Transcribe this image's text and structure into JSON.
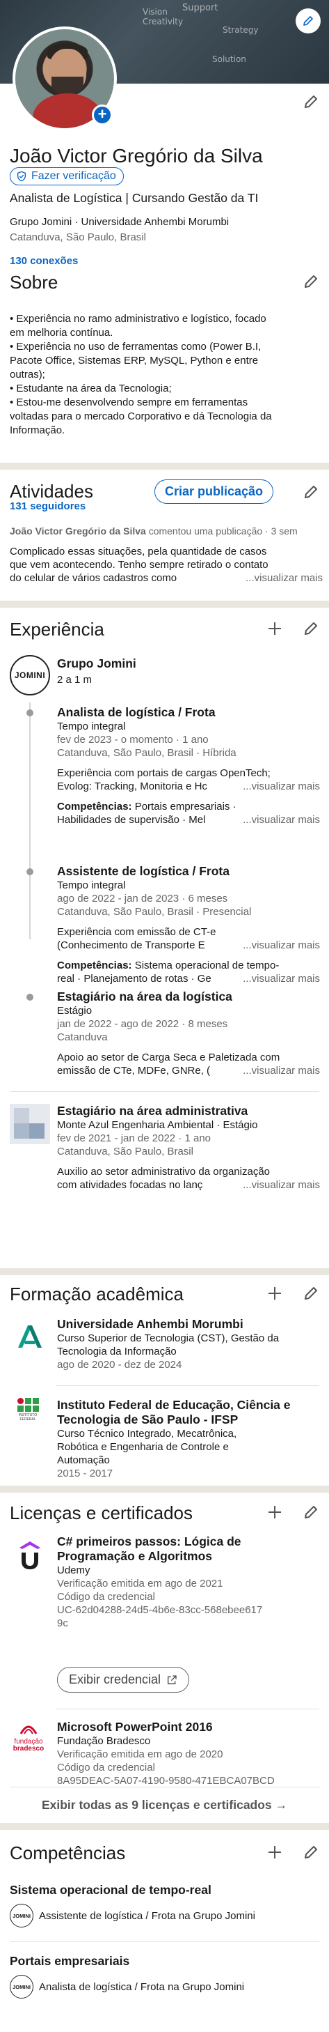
{
  "banner": {
    "doodles": [
      "Vision",
      "Creativity",
      "Support",
      "Strategy",
      "Solution"
    ]
  },
  "profile": {
    "name": "João Victor Gregório da Silva",
    "verify_label": "Fazer verificação",
    "headline": "Analista de Logística | Cursando Gestão da TI",
    "education_line": "Grupo Jomini · Universidade Anhembi Morumbi",
    "location": "Catanduva, São Paulo, Brasil",
    "connections": "130 conexões"
  },
  "about": {
    "title": "Sobre",
    "lines": [
      "• Experiência no ramo administrativo e logístico, focado",
      "em melhoria contínua.",
      "• Experiência no uso de ferramentas como (Power B.I,",
      "Pacote Office, Sistemas ERP, MySQL, Python e entre",
      "outras);",
      "• Estudante na área da Tecnologia;",
      "• Estou-me desenvolvendo sempre em ferramentas",
      "voltadas para o mercado Corporativo e dá Tecnologia da",
      "Informação."
    ]
  },
  "activity": {
    "title": "Atividades",
    "followers": "131 seguidores",
    "create_label": "Criar publicação",
    "author": "João Victor Gregório da Silva",
    "action": " comentou uma publicação · 3 sem",
    "post_line1": "Complicado essas situações, pela quantidade de casos",
    "post_line2": "que vem acontecendo. Tenho sempre retirado o contato",
    "post_line3": "do celular de vários cadastros como",
    "see_more": "...visualizar mais"
  },
  "experience": {
    "title": "Experiência",
    "company": "Grupo Jomini",
    "company_logo": "JOMINI",
    "company_duration": "2 a 1 m",
    "roles": [
      {
        "title": "Analista de logística / Frota",
        "type": "Tempo integral",
        "dates": "fev de 2023 - o momento · 1 ano",
        "place": "Catanduva, São Paulo, Brasil · Híbrida",
        "desc1": "Experiência com portais de cargas OpenTech;",
        "desc2": "Evolog: Tracking, Monitoria e Hc",
        "see_more": "...visualizar mais",
        "skills_label": "Competências:",
        "skills1": " Portais empresariais ·",
        "skills2": "Habilidades de supervisão · Mel",
        "skills_more": "...visualizar mais"
      },
      {
        "title": "Assistente de logística / Frota",
        "type": "Tempo integral",
        "dates": "ago de 2022 - jan de 2023 · 6 meses",
        "place": "Catanduva, São Paulo, Brasil · Presencial",
        "desc1": "Experiência com emissão de CT-e",
        "desc2": "(Conhecimento de Transporte E",
        "see_more": "...visualizar mais",
        "skills_label": "Competências:",
        "skills1": " Sistema operacional de tempo-",
        "skills2": "real · Planejamento de rotas · Ge",
        "skills_more": "...visualizar mais"
      },
      {
        "title": "Estagiário na área da logística",
        "type": "Estágio",
        "dates": "jan de 2022 - ago de 2022 · 8 meses",
        "place": "Catanduva",
        "desc1": "Apoio ao setor de Carga Seca e Paletizada com",
        "desc2": "emissão de CTe, MDFe, GNRe, (",
        "see_more": "...visualizar mais"
      }
    ],
    "other": {
      "title": "Estagiário na área administrativa",
      "company": "Monte Azul Engenharia Ambiental · Estágio",
      "dates": "fev de 2021 - jan de 2022 · 1 ano",
      "place": "Catanduva, São Paulo, Brasil",
      "desc1": "Auxilio ao setor administrativo da organização",
      "desc2": "com atividades focadas no lanç",
      "see_more": "...visualizar mais"
    }
  },
  "education": {
    "title": "Formação acadêmica",
    "items": [
      {
        "school": "Universidade Anhembi Morumbi",
        "degree1": "Curso Superior de Tecnologia (CST), Gestão da",
        "degree2": "Tecnologia da Informação",
        "dates": "ago de 2020 - dez de 2024"
      },
      {
        "school1": "Instituto Federal de Educação, Ciência e",
        "school2": "Tecnologia de São Paulo - IFSP",
        "degree1": "Curso Técnico Integrado, Mecatrônica,",
        "degree2": "Robótica e Engenharia de Controle e",
        "degree3": "Automação",
        "dates": "2015 - 2017",
        "logo_text": "INSTITUTO FEDERAL"
      }
    ]
  },
  "licenses": {
    "title": "Licenças e certificados",
    "items": [
      {
        "title1": "C# primeiros passos: Lógica de",
        "title2": "Programação e Algoritmos",
        "issuer": "Udemy",
        "issued": "Verificação emitida em ago de 2021",
        "cred_label": "Código da credencial",
        "cred_id1": "UC-62d04288-24d5-4b6e-83cc-568ebee617",
        "cred_id2": "9c",
        "show_label": "Exibir credencial"
      },
      {
        "title": "Microsoft PowerPoint 2016",
        "issuer": "Fundação Bradesco",
        "issued": "Verificação emitida em ago de 2020",
        "cred_label": "Código da credencial",
        "cred_id": "8A95DEAC-5A07-4190-9580-471EBCA07BCD",
        "logo_text1": "fundação",
        "logo_text2": "bradesco"
      }
    ],
    "show_all": "Exibir todas as 9 licenças e certificados →"
  },
  "skills": {
    "title": "Competências",
    "items": [
      {
        "name": "Sistema operacional de tempo-real",
        "context": "Assistente de logística / Frota na Grupo Jomini"
      },
      {
        "name": "Portais empresariais",
        "context": "Analista de logística / Frota na Grupo Jomini"
      }
    ]
  },
  "colors": {
    "brand": "#0a66c2",
    "separator": "#e9e5df",
    "text": "#191919",
    "muted": "#666666"
  },
  "icons": [
    "pencil-icon",
    "plus-icon",
    "shield-check-icon",
    "external-link-icon",
    "camera-add-icon"
  ]
}
